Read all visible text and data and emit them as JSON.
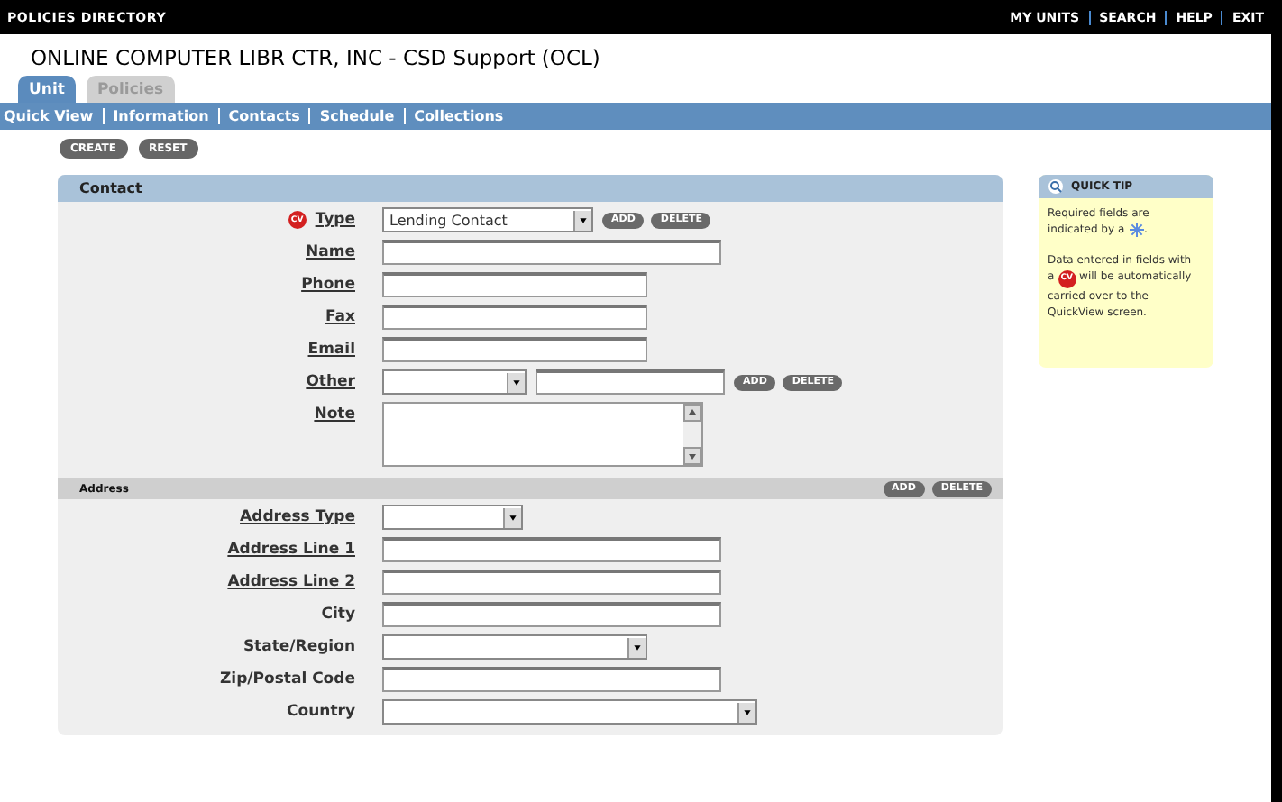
{
  "top_bar": {
    "title": "POLICIES DIRECTORY",
    "links": [
      "MY UNITS",
      "SEARCH",
      "HELP",
      "EXIT"
    ]
  },
  "page_title": "ONLINE COMPUTER LIBR CTR, INC - CSD Support (OCL)",
  "tabs": [
    {
      "label": "Unit",
      "selected": true
    },
    {
      "label": "Policies",
      "selected": false
    }
  ],
  "subnav": [
    "Quick View",
    "Information",
    "Contacts",
    "Schedule",
    "Collections"
  ],
  "actions": [
    "CREATE",
    "RESET"
  ],
  "contact": {
    "title": "Contact",
    "fields": [
      {
        "label": "Type",
        "link": true,
        "badge": "CV",
        "kind": "select_medium",
        "value": "Lending Contact",
        "buttons": [
          "ADD",
          "DELETE"
        ]
      },
      {
        "label": "Name",
        "link": true,
        "kind": "text_long"
      },
      {
        "label": "Phone",
        "link": true,
        "kind": "text_medium"
      },
      {
        "label": "Fax",
        "link": true,
        "kind": "text_medium"
      },
      {
        "label": "Email",
        "link": true,
        "kind": "text_medium"
      },
      {
        "label": "Other",
        "link": true,
        "kind": "select_text",
        "buttons": [
          "ADD",
          "DELETE"
        ]
      },
      {
        "label": "Note",
        "link": true,
        "kind": "textarea"
      }
    ]
  },
  "address": {
    "title": "Address",
    "buttons": [
      "ADD",
      "DELETE"
    ],
    "fields": [
      {
        "label": "Address Type",
        "link": true,
        "kind": "select_short"
      },
      {
        "label": "Address Line 1",
        "link": true,
        "kind": "text_long"
      },
      {
        "label": "Address Line 2",
        "link": true,
        "kind": "text_long"
      },
      {
        "label": "City",
        "link": false,
        "kind": "text_long"
      },
      {
        "label": "State/Region",
        "link": false,
        "kind": "select_long"
      },
      {
        "label": "Zip/Postal Code",
        "link": false,
        "kind": "text_long"
      },
      {
        "label": "Country",
        "link": false,
        "kind": "select_wide"
      }
    ]
  },
  "quick_tip": {
    "title": "QUICK TIP",
    "required_before": "Required fields are indicated by a",
    "required_after": ".",
    "carry_before": "Data entered in fields with a",
    "carry_badge": "CV",
    "carry_after": "will be automatically carried over to the QuickView screen."
  }
}
